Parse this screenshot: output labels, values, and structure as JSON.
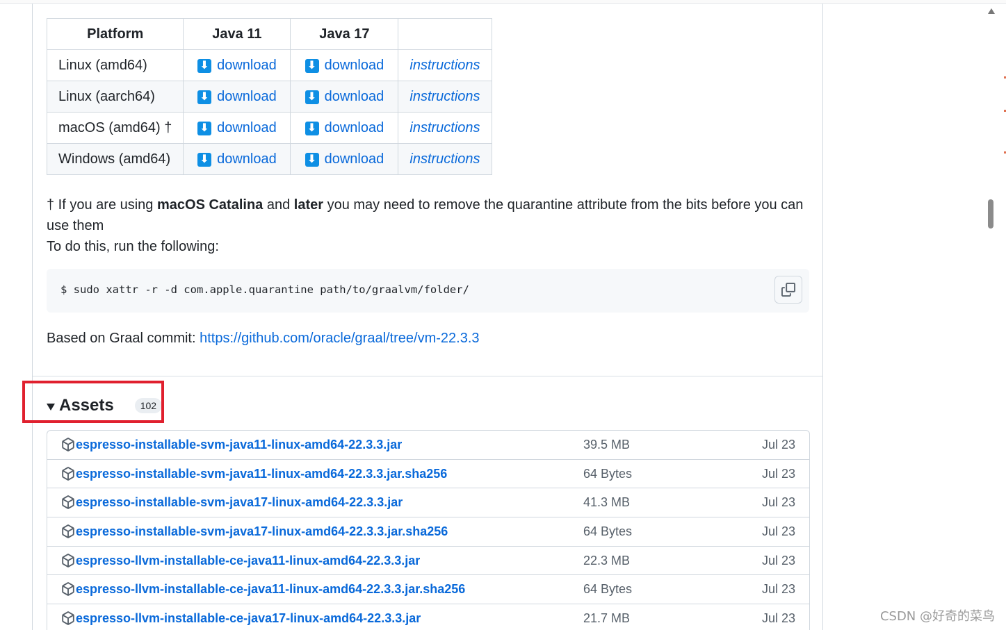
{
  "table": {
    "headers": [
      "Platform",
      "Java 11",
      "Java 17",
      ""
    ],
    "rows": [
      {
        "platform": "Linux (amd64)",
        "j11": "download",
        "j17": "download",
        "instructions": "instructions"
      },
      {
        "platform": "Linux (aarch64)",
        "j11": "download",
        "j17": "download",
        "instructions": "instructions"
      },
      {
        "platform": "macOS (amd64) †",
        "j11": "download",
        "j17": "download",
        "instructions": "instructions"
      },
      {
        "platform": "Windows (amd64)",
        "j11": "download",
        "j17": "download",
        "instructions": "instructions"
      }
    ]
  },
  "note": {
    "dagger": "†",
    "pre": " If you are using ",
    "bold1": "macOS Catalina",
    "mid": " and ",
    "bold2": "later",
    "post": " you may need to remove the quarantine attribute from the bits before you can use them",
    "line2": "To do this, run the following:"
  },
  "code": {
    "command": "$ sudo xattr -r -d com.apple.quarantine path/to/graalvm/folder/",
    "copy_icon": "copy-icon"
  },
  "commit": {
    "label": "Based on Graal commit: ",
    "url": "https://github.com/oracle/graal/tree/vm-22.3.3"
  },
  "assets": {
    "title": "Assets",
    "count": "102",
    "items": [
      {
        "name": "espresso-installable-svm-java11-linux-amd64-22.3.3.jar",
        "size": "39.5 MB",
        "date": "Jul 23"
      },
      {
        "name": "espresso-installable-svm-java11-linux-amd64-22.3.3.jar.sha256",
        "size": "64 Bytes",
        "date": "Jul 23"
      },
      {
        "name": "espresso-installable-svm-java17-linux-amd64-22.3.3.jar",
        "size": "41.3 MB",
        "date": "Jul 23"
      },
      {
        "name": "espresso-installable-svm-java17-linux-amd64-22.3.3.jar.sha256",
        "size": "64 Bytes",
        "date": "Jul 23"
      },
      {
        "name": "espresso-llvm-installable-ce-java11-linux-amd64-22.3.3.jar",
        "size": "22.3 MB",
        "date": "Jul 23"
      },
      {
        "name": "espresso-llvm-installable-ce-java11-linux-amd64-22.3.3.jar.sha256",
        "size": "64 Bytes",
        "date": "Jul 23"
      },
      {
        "name": "espresso-llvm-installable-ce-java17-linux-amd64-22.3.3.jar",
        "size": "21.7 MB",
        "date": "Jul 23"
      }
    ]
  },
  "watermark": "CSDN @好奇的菜鸟",
  "colors": {
    "link": "#0969da",
    "download_icon": "#0e8fe4",
    "highlight": "#e0202e"
  }
}
